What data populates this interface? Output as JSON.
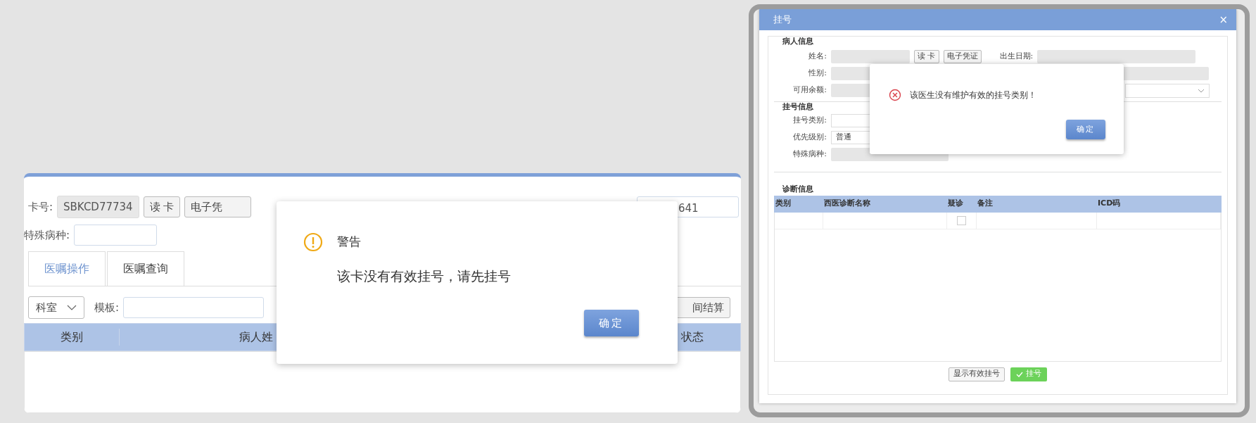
{
  "order_panel": {
    "card_label": "卡号:",
    "card_value": "SBKCD77734",
    "read_card_button": "读 卡",
    "e_voucher_button": "电子凭",
    "visit_field_value": "641",
    "special_disease_label": "特殊病种:"
  },
  "tabs": [
    {
      "label": "医嘱操作",
      "selected": true
    },
    {
      "label": "医嘱查询",
      "selected": false
    }
  ],
  "toolbar": {
    "department_select": "科室",
    "template_label": "模板:",
    "settle_button": "间结算"
  },
  "table": {
    "columns": [
      "类别",
      "病人姓",
      "状态"
    ]
  },
  "warning_dialog": {
    "title": "警告",
    "message": "该卡没有有效挂号，请先挂号",
    "ok_button": "确定"
  },
  "register_window": {
    "title": "挂号",
    "close": "×",
    "patient_section": "病人信息",
    "name_label": "姓名:",
    "read_card_button": "读 卡",
    "e_voucher_button": "电子凭证",
    "birth_label": "出生日期:",
    "gender_label": "性别:",
    "balance_label": "可用余额:",
    "register_section": "挂号信息",
    "register_type_label": "挂号类别:",
    "priority_label": "优先级别:",
    "priority_value": "普通",
    "special_disease_label": "特殊病种:",
    "diagnosis_section": "诊断信息",
    "diagnosis_table": {
      "columns": [
        "类别",
        "西医诊断名称",
        "疑诊",
        "备注",
        "ICD码"
      ],
      "rows": [
        {
          "suspected": false
        }
      ]
    },
    "show_valid_button": "显示有效挂号",
    "register_button": "挂号"
  },
  "error_dialog": {
    "message": "该医生没有维护有效的挂号类别！",
    "ok_button": "确定"
  }
}
